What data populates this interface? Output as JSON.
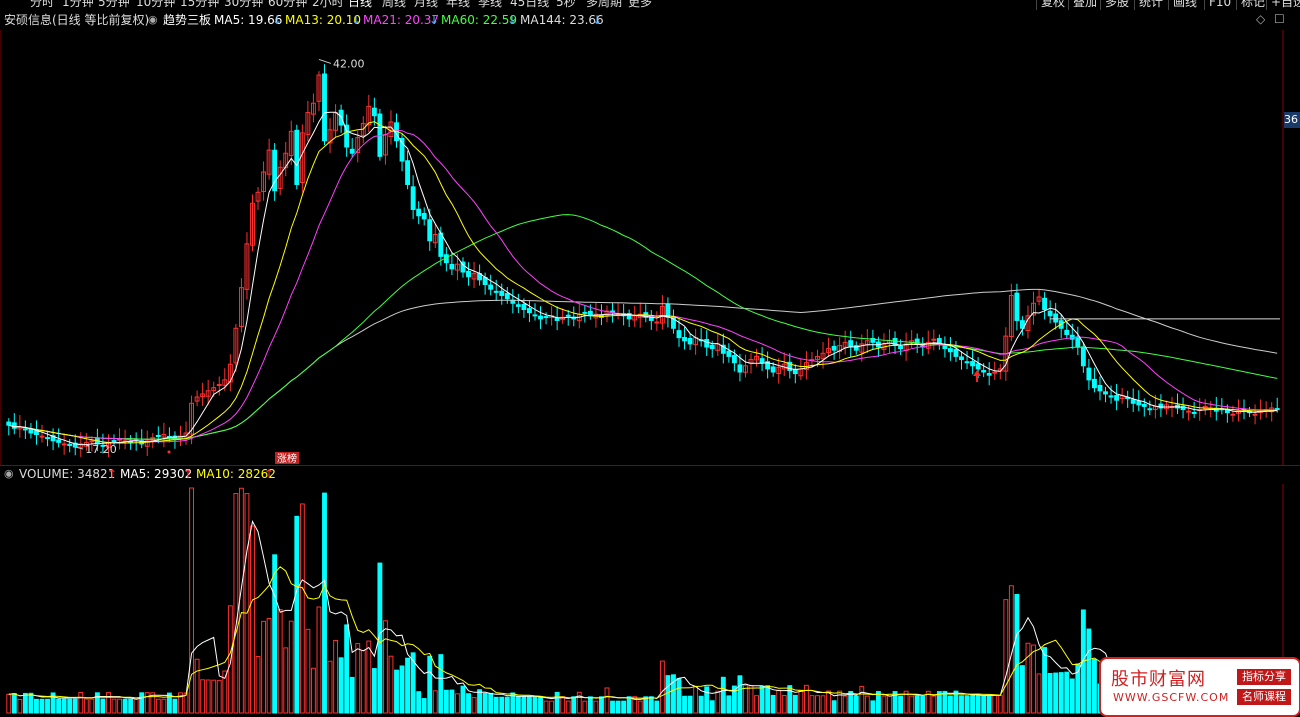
{
  "toolbar": {
    "periods": [
      "分时",
      "1分钟",
      "5分钟",
      "10分钟",
      "15分钟",
      "30分钟",
      "60分钟",
      "2小时",
      "日线",
      "周线",
      "月线",
      "年线",
      "季线",
      "45日线",
      "5秒",
      "多周期",
      "更多"
    ],
    "active_period": "日线",
    "right_buttons": [
      "复权",
      "叠加",
      "多股",
      "统计",
      "画线",
      "F10",
      "标记",
      "+自选"
    ]
  },
  "header": {
    "stock": "安硕信息(日线 等比前复权)",
    "indicator": "趋势三板",
    "ma5_label": "MA5: 19.66",
    "ma13_label": "MA13: 20.10",
    "ma21_label": "MA21: 20.37",
    "ma60_label": "MA60: 22.59",
    "ma144_label": "MA144: 23.66",
    "arrow_down": "↓",
    "colors": {
      "ma5": "#ffffff",
      "ma13": "#ffff00",
      "ma21": "#ff40ff",
      "ma60": "#40ff40",
      "ma144": "#cccccc"
    }
  },
  "price_chart": {
    "high_label": "42.00",
    "low_label": "17.20",
    "badge": "涨榜",
    "right_axis_label": "36"
  },
  "volume_header": {
    "volume_label": "VOLUME: 34821",
    "ma5_label": "MA5: 29302",
    "ma10_label": "MA10: 28262",
    "arrow_up": "↑"
  },
  "watermark": {
    "title": "股市财富网",
    "url": "WWW.GSCFW.COM",
    "tag1": "指标分享",
    "tag2": "名师课程"
  },
  "chart_data": {
    "type": "candlestick",
    "title": "安硕信息(日线 等比前复权)",
    "colors": {
      "up": "#ff3030",
      "down": "#00ffff",
      "ma5": "#ffffff",
      "ma13": "#ffff00",
      "ma21": "#ff40ff",
      "ma60": "#40ff40",
      "ma144": "#cccccc"
    },
    "closes": [
      18.6,
      18.4,
      18.5,
      18.3,
      18.1,
      18.0,
      17.9,
      17.8,
      17.6,
      17.5,
      17.4,
      17.3,
      17.2,
      17.4,
      17.5,
      17.6,
      17.4,
      17.3,
      17.5,
      17.6,
      17.7,
      17.6,
      17.5,
      17.6,
      17.4,
      17.6,
      17.8,
      17.9,
      18.0,
      17.8,
      17.7,
      17.9,
      18.1,
      20.0,
      20.4,
      20.6,
      20.8,
      21.0,
      21.2,
      21.5,
      22.5,
      24.8,
      27.4,
      30.2,
      32.8,
      33.5,
      34.8,
      36.2,
      33.6,
      35.1,
      36.0,
      37.4,
      34.0,
      37.3,
      38.6,
      39.2,
      41.0,
      36.8,
      37.5,
      38.6,
      37.8,
      36.4,
      36.0,
      37.0,
      37.9,
      39.0,
      38.4,
      35.8,
      37.2,
      38.0,
      36.8,
      35.5,
      34.0,
      32.4,
      32.0,
      31.8,
      30.4,
      30.8,
      29.4,
      29.0,
      28.6,
      28.9,
      28.4,
      28.1,
      28.3,
      27.9,
      27.6,
      27.3,
      27.1,
      26.9,
      26.7,
      26.4,
      26.2,
      26.0,
      25.8,
      25.6,
      25.4,
      25.5,
      25.6,
      25.3,
      25.5,
      25.6,
      25.4,
      25.7,
      25.8,
      25.6,
      25.7,
      25.5,
      25.9,
      25.8,
      25.7,
      25.6,
      25.4,
      25.6,
      25.7,
      25.5,
      25.3,
      25.2,
      26.2,
      25.5,
      24.8,
      24.2,
      24.0,
      23.8,
      24.2,
      24.0,
      23.6,
      23.5,
      23.8,
      23.2,
      23.0,
      22.6,
      22.0,
      22.4,
      22.8,
      23.0,
      22.6,
      22.2,
      22.0,
      22.3,
      22.5,
      22.1,
      21.9,
      22.2,
      22.6,
      22.8,
      23.0,
      23.2,
      23.5,
      23.4,
      23.7,
      23.9,
      23.6,
      23.4,
      23.8,
      24.0,
      23.9,
      23.6,
      23.8,
      24.0,
      23.7,
      23.5,
      23.8,
      24.0,
      23.8,
      23.6,
      23.9,
      24.1,
      23.8,
      23.5,
      23.3,
      23.0,
      22.8,
      22.6,
      22.4,
      22.2,
      22.0,
      21.8,
      22.0,
      22.2,
      24.3,
      26.9,
      25.3,
      24.8,
      25.6,
      26.4,
      26.8,
      26.0,
      25.6,
      25.2,
      24.8,
      24.4,
      24.1,
      23.6,
      22.4,
      21.5,
      21.0,
      20.8,
      20.6,
      20.4,
      20.2,
      20.5,
      20.3,
      20.0,
      19.9,
      19.8,
      19.6,
      19.8,
      19.7,
      19.9,
      19.8,
      19.7,
      19.6,
      19.5,
      19.4,
      19.6,
      19.8,
      19.7,
      19.5,
      19.6,
      19.4,
      19.3,
      19.5,
      19.6,
      19.4,
      19.3,
      19.5,
      19.6,
      19.7,
      19.66
    ],
    "high": 42.0,
    "low": 17.2,
    "ma_latest": {
      "MA5": 19.66,
      "MA13": 20.1,
      "MA21": 20.37,
      "MA60": 22.59,
      "MA144": 23.66
    },
    "volume_latest": {
      "VOLUME": 34821,
      "MA5": 29302,
      "MA10": 28262
    }
  }
}
